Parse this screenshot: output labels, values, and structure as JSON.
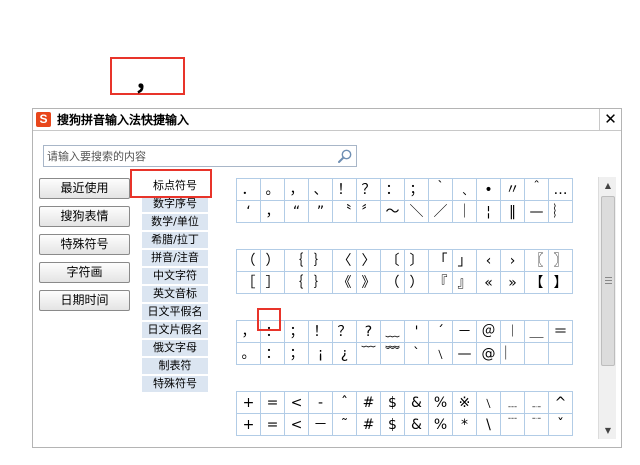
{
  "preview": {
    "char": "，"
  },
  "window": {
    "title": "搜狗拼音输入法快捷输入",
    "close": "✕",
    "app_icon": "S"
  },
  "search": {
    "placeholder": "请输入要搜索的内容"
  },
  "side_buttons": [
    "最近使用",
    "搜狗表情",
    "特殊符号",
    "字符画",
    "日期时间"
  ],
  "categories": [
    "标点符号",
    "数字序号",
    "数学/单位",
    "希腊/拉丁",
    "拼音/注音",
    "中文字符",
    "英文音标",
    "日文平假名",
    "日文片假名",
    "俄文字母",
    "制表符",
    "特殊符号"
  ],
  "selected_category": 0,
  "symbol_blocks": [
    {
      "rows": [
        [
          "．",
          "。",
          "，",
          "、",
          "！",
          "？",
          "：",
          "；",
          "｀",
          "﹑",
          "•",
          "〃",
          "＾",
          "…"
        ],
        [
          "‘",
          "，",
          "“",
          "”",
          "〝",
          "〞",
          "～",
          "＼",
          "／",
          "｜",
          "¦",
          "‖",
          "—",
          "︴"
        ]
      ]
    },
    {
      "rows": [
        [
          "（",
          "）",
          "｛",
          "｝",
          "〈",
          "〉",
          "〔",
          "〕",
          "「",
          "」",
          "‹",
          "›",
          "〖",
          "〗"
        ],
        [
          "［",
          "］",
          "｛",
          "｝",
          "《",
          "》",
          "（",
          "）",
          "『",
          "』",
          "«",
          "»",
          "【",
          "】"
        ]
      ]
    },
    {
      "rows": [
        [
          "，",
          "：",
          "；",
          "！",
          "？",
          "?",
          "﹏",
          "'",
          "ˊ",
          "－",
          "＠",
          "︱",
          "＿",
          "＝"
        ],
        [
          "。",
          "：",
          "；",
          "¡",
          "¿",
          "﹋",
          "﹌",
          "ˋ",
          "﹨",
          "—",
          "@",
          "︳",
          "",
          ""
        ]
      ]
    },
    {
      "rows": [
        [
          "+",
          "=",
          "<",
          "-",
          "ˆ",
          "#",
          "$",
          "&",
          "%",
          "※",
          "﹨",
          "﹍",
          "﹎",
          "^"
        ],
        [
          "+",
          "=",
          "<",
          "－",
          "˜",
          "#",
          "$",
          "&",
          "%",
          "*",
          "\\",
          "﹉",
          "﹊",
          "ˇ"
        ]
      ]
    }
  ],
  "scroll": {
    "up": "▲",
    "down": "▼"
  }
}
